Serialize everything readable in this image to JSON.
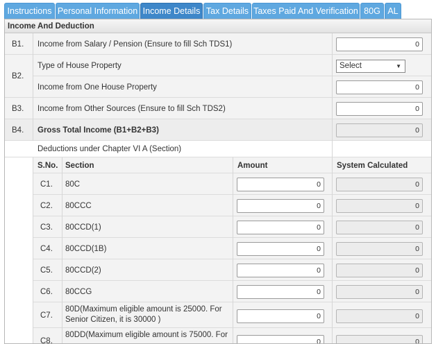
{
  "tabs": [
    {
      "label": "Instructions"
    },
    {
      "label": "Personal Information"
    },
    {
      "label": "Income Details"
    },
    {
      "label": "Tax Details"
    },
    {
      "label": "Taxes Paid And Verification"
    },
    {
      "label": "80G"
    },
    {
      "label": "AL"
    }
  ],
  "active_tab": "Income Details",
  "section_title": "Income And Deduction",
  "rows": {
    "b1": {
      "code": "B1.",
      "label": "Income from Salary / Pension (Ensure to fill Sch TDS1)",
      "value": "0"
    },
    "b2": {
      "code": "B2.",
      "type_label": "Type of House Property",
      "select_value": "Select",
      "income_label": "Income from One House Property",
      "income_value": "0"
    },
    "b3": {
      "code": "B3.",
      "label": "Income from Other Sources (Ensure to fill Sch TDS2)",
      "value": "0"
    },
    "b4": {
      "code": "B4.",
      "label": "Gross Total Income (B1+B2+B3)",
      "value": "0"
    }
  },
  "deductions": {
    "title": "Deductions under Chapter VI A (Section)",
    "headers": {
      "sno": "S.No.",
      "section": "Section",
      "amount": "Amount",
      "system": "System Calculated"
    },
    "items": [
      {
        "sno": "C1.",
        "section": "80C",
        "amount": "0",
        "system": "0"
      },
      {
        "sno": "C2.",
        "section": "80CCC",
        "amount": "0",
        "system": "0"
      },
      {
        "sno": "C3.",
        "section": "80CCD(1)",
        "amount": "0",
        "system": "0"
      },
      {
        "sno": "C4.",
        "section": "80CCD(1B)",
        "amount": "0",
        "system": "0"
      },
      {
        "sno": "C5.",
        "section": "80CCD(2)",
        "amount": "0",
        "system": "0"
      },
      {
        "sno": "C6.",
        "section": "80CCG",
        "amount": "0",
        "system": "0"
      },
      {
        "sno": "C7.",
        "section_line1": "80D(Maximum eligible amount is 25000. For",
        "section_line2": "Senior Citizen, it is 30000 )",
        "amount": "0",
        "system": "0"
      },
      {
        "sno": "C8.",
        "section_line1": "80DD(Maximum eligible amount is 75000. For",
        "amount": "0",
        "system": "0"
      }
    ]
  }
}
